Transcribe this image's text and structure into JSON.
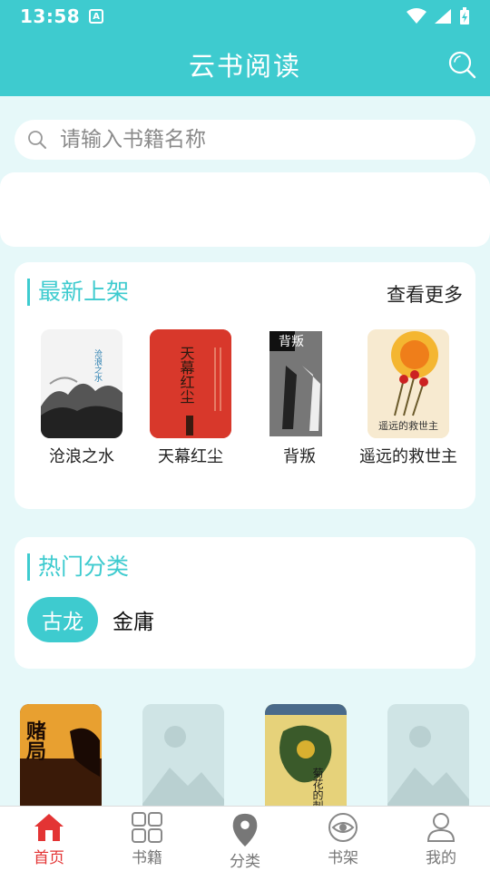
{
  "status_bar": {
    "time": "13:58",
    "badge": "A"
  },
  "app_bar": {
    "title": "云书阅读"
  },
  "search": {
    "placeholder": "请输入书籍名称"
  },
  "latest": {
    "title": "最新上架",
    "more": "查看更多",
    "books": [
      {
        "title": "沧浪之水",
        "cover_text": "沧浪之水"
      },
      {
        "title": "天幕红尘",
        "cover_text": "天幕红尘"
      },
      {
        "title": "背叛",
        "cover_text": "背叛"
      },
      {
        "title": "遥远的救世主",
        "cover_text": "遥远的救世主"
      }
    ]
  },
  "hot": {
    "title": "热门分类",
    "tags": [
      {
        "label": "古龙",
        "active": true
      },
      {
        "label": "金庸",
        "active": false
      }
    ]
  },
  "grid_books": [
    {
      "cover_text": "赌局",
      "placeholder": false
    },
    {
      "cover_text": "",
      "placeholder": true
    },
    {
      "cover_text": "菊花的刺",
      "placeholder": false
    },
    {
      "cover_text": "",
      "placeholder": true
    }
  ],
  "tabs": [
    {
      "label": "首页",
      "icon": "home-icon",
      "active": true
    },
    {
      "label": "书籍",
      "icon": "grid-icon",
      "active": false
    },
    {
      "label": "分类",
      "icon": "location-pin-icon",
      "active": false
    },
    {
      "label": "书架",
      "icon": "eye-icon",
      "active": false
    },
    {
      "label": "我的",
      "icon": "person-icon",
      "active": false
    }
  ],
  "colors": {
    "primary": "#3ecbcf",
    "background": "#e6f8f9",
    "active_tab": "#e33434"
  }
}
